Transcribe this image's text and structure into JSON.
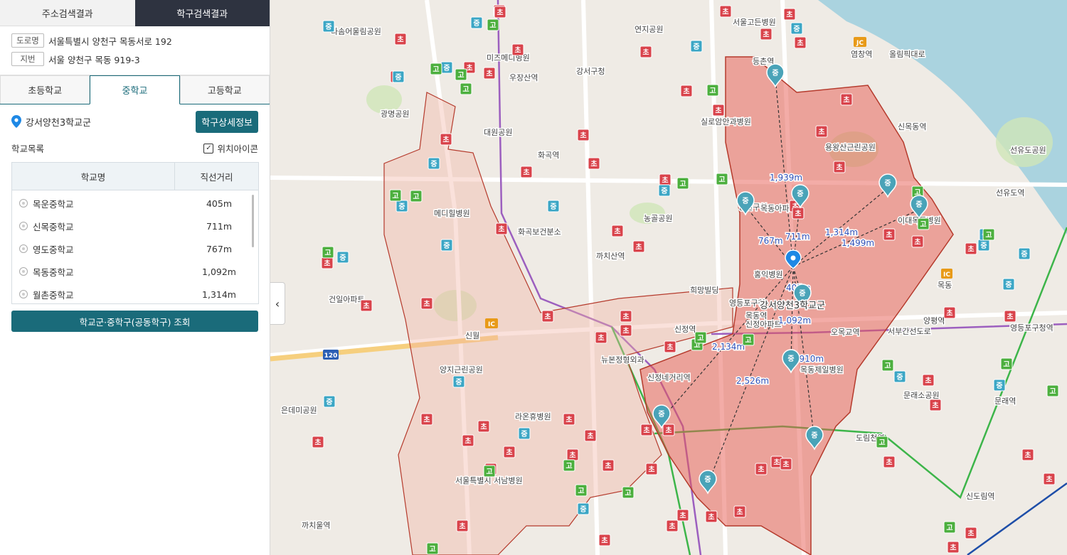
{
  "tabs": {
    "address": "주소검색결과",
    "district": "학구검색결과"
  },
  "address": {
    "road_tag": "도로명",
    "road": "서울특별시 양천구 목동서로 192",
    "lot_tag": "지번",
    "lot": "서울 양천구 목동 919-3"
  },
  "levels": {
    "elementary": "초등학교",
    "middle": "중학교",
    "high": "고등학교"
  },
  "district": {
    "name": "강서양천3학교군",
    "detail_button": "학구상세정보"
  },
  "list": {
    "title": "학교목록",
    "location_icon_label": "위치아이콘",
    "col_name": "학교명",
    "col_distance": "직선거리",
    "schools": [
      {
        "name": "목운중학교",
        "distance": "405m"
      },
      {
        "name": "신목중학교",
        "distance": "711m"
      },
      {
        "name": "영도중학교",
        "distance": "767m"
      },
      {
        "name": "목동중학교",
        "distance": "1,092m"
      },
      {
        "name": "월촌중학교",
        "distance": "1,314m"
      }
    ],
    "lookup_button": "학교군·중학구(공동학구) 조회"
  },
  "map": {
    "center_label": "강서양천3학교군",
    "distances": [
      "405m",
      "711m",
      "767m",
      "1,092m",
      "1,314m",
      "1,499m",
      "1,910m",
      "1,939m",
      "2,134m",
      "2,526m"
    ],
    "places": [
      "화곡역",
      "우장산역",
      "까치산역",
      "신정역",
      "목동역",
      "오목교역",
      "신정네거리역",
      "양평역",
      "영등포구청역",
      "신도림역",
      "도림천역",
      "문래역",
      "등촌역",
      "염창역",
      "신목동역",
      "선유도역",
      "까치울역",
      "강서구청",
      "양천구청",
      "영등포구청",
      "신월",
      "목동",
      "화곡보건분소",
      "메디힐병원",
      "서울고든병원",
      "미즈메디병원",
      "희망빌딩",
      "뉴본정형외과",
      "라온휴병원",
      "서울특별시 서남병원",
      "목동제일병원",
      "이대목동병원",
      "홍익병원",
      "용왕산근린공원",
      "양지근린공원",
      "선유도공원",
      "대원공원",
      "농골공원",
      "은데미공원",
      "다솜어울림공원",
      "광명공원",
      "연지공원",
      "건일아파트",
      "목동아파트",
      "신정아파트",
      "문래소공원",
      "올림픽대로",
      "서부간선도로",
      "실로암안과병원"
    ],
    "marker_labels": {
      "middle": "중",
      "elementary": "초",
      "high": "고",
      "ic": "IC",
      "jc": "JC",
      "route": "120"
    }
  }
}
